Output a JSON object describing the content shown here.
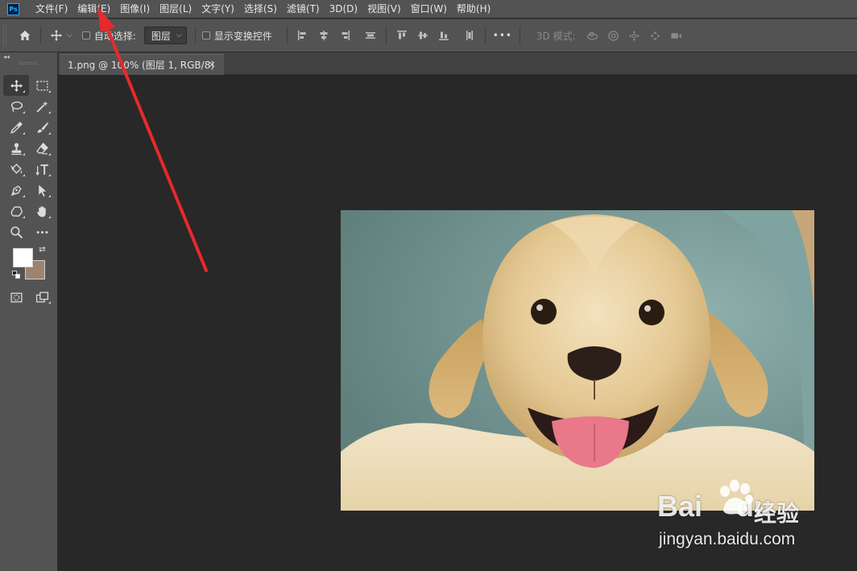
{
  "app": {
    "logo_text": "Ps"
  },
  "menu": [
    "文件(F)",
    "编辑(E)",
    "图像(I)",
    "图层(L)",
    "文字(Y)",
    "选择(S)",
    "滤镜(T)",
    "3D(D)",
    "视图(V)",
    "窗口(W)",
    "帮助(H)"
  ],
  "options_bar": {
    "auto_select_label": "自动选择:",
    "auto_select_checked": false,
    "auto_select_target": "图层",
    "show_transform_label": "显示变换控件",
    "show_transform_checked": false,
    "more_label": "•••",
    "mode_3d_label": "3D 模式:"
  },
  "toolbox": {
    "collapse_label": "◂◂",
    "foreground_color": "#ffffff",
    "background_color": "#9c8470"
  },
  "document": {
    "tab_title": "1.png @ 100% (图层 1, RGB/8)",
    "close_label": "×"
  },
  "watermark": {
    "brand": "Bai",
    "brand_suffix": "du",
    "service": "经验",
    "url": "jingyan.baidu.com"
  },
  "colors": {
    "menubar_bg": "#535353",
    "canvas_bg": "#282828",
    "accent_blue": "#31a8ff",
    "annotation_red": "#e8292b"
  }
}
